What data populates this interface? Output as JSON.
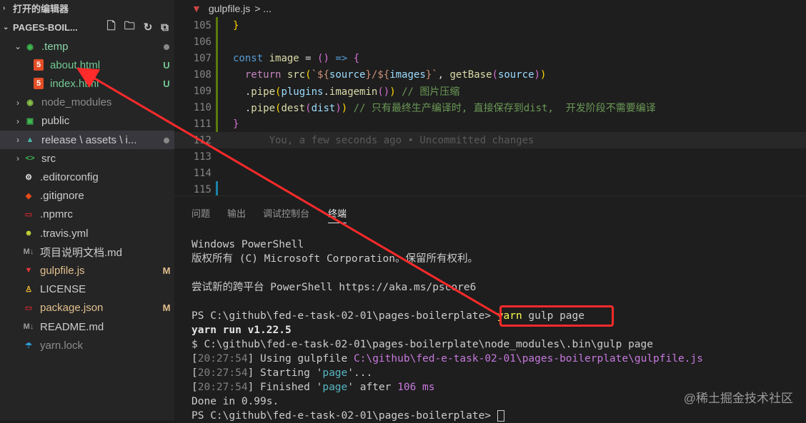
{
  "explorer": {
    "open_editors": "打开的编辑器",
    "folder_name": "PAGES-BOIL...",
    "tree": [
      {
        "label": ".temp",
        "badge": "",
        "color": "#8bd6a8"
      },
      {
        "label": "about.html",
        "badge": "U",
        "color": "#73c991"
      },
      {
        "label": "index.html",
        "badge": "U",
        "color": "#73c991"
      },
      {
        "label": "node_modules",
        "badge": "",
        "color": "#8c8c8c"
      },
      {
        "label": "public",
        "badge": "",
        "color": "#cccccc"
      },
      {
        "label": "release \\ assets \\ i...",
        "badge": "",
        "color": "#cccccc"
      },
      {
        "label": "src",
        "badge": "",
        "color": "#cccccc"
      },
      {
        "label": ".editorconfig",
        "badge": "",
        "color": "#cccccc"
      },
      {
        "label": ".gitignore",
        "badge": "",
        "color": "#cccccc"
      },
      {
        "label": ".npmrc",
        "badge": "",
        "color": "#cccccc"
      },
      {
        "label": ".travis.yml",
        "badge": "",
        "color": "#cccccc"
      },
      {
        "label": "项目说明文档.md",
        "badge": "",
        "color": "#cccccc"
      },
      {
        "label": "gulpfile.js",
        "badge": "M",
        "color": "#e2c08d"
      },
      {
        "label": "LICENSE",
        "badge": "",
        "color": "#cccccc"
      },
      {
        "label": "package.json",
        "badge": "M",
        "color": "#e2c08d"
      },
      {
        "label": "README.md",
        "badge": "",
        "color": "#cccccc"
      },
      {
        "label": "yarn.lock",
        "badge": "",
        "color": "#8c8c8c"
      }
    ]
  },
  "breadcrumb": {
    "file": "gulpfile.js",
    "rest": "> ..."
  },
  "editor": {
    "line_numbers": [
      "105",
      "106",
      "107",
      "108",
      "109",
      "110",
      "111",
      "112",
      "113",
      "114",
      "115"
    ],
    "blame": "You, a few seconds ago • Uncommitted changes"
  },
  "panel": {
    "tabs": [
      "问题",
      "输出",
      "调试控制台",
      "终端"
    ],
    "active_tab": "终端"
  },
  "terminal": {
    "l1": "Windows PowerShell",
    "l2": "版权所有 (C) Microsoft Corporation。保留所有权利。",
    "l3": "尝试新的跨平台 PowerShell https://aka.ms/pscore6",
    "prompt": "PS C:\\github\\fed-e-task-02-01\\pages-boilerplate>",
    "cmd_yarn": "yarn",
    "cmd_rest": " gulp page",
    "l5": "yarn run v1.22.5",
    "l6": "$ C:\\github\\fed-e-task-02-01\\pages-boilerplate\\node_modules\\.bin\\gulp page",
    "t1": "20:27:54",
    "using": " Using gulpfile ",
    "gulpfile_path": "C:\\github\\fed-e-task-02-01\\pages-boilerplate\\gulpfile.js",
    "starting": " Starting '",
    "page": "page",
    "dots": "'...",
    "finished": " Finished '",
    "after": "' after ",
    "ms": "106 ms",
    "done": "Done in 0.99s.",
    "prompt2": "PS C:\\github\\fed-e-task-02-01\\pages-boilerplate>"
  },
  "watermark": "@稀土掘金技术社区"
}
